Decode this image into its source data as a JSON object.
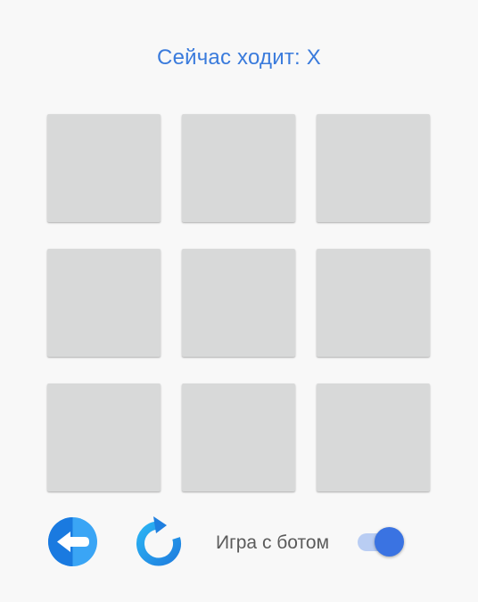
{
  "status": {
    "text": "Сейчас ходит: X"
  },
  "board": {
    "cells": [
      "",
      "",
      "",
      "",
      "",
      "",
      "",
      "",
      ""
    ]
  },
  "controls": {
    "back_icon": "arrow-left-icon",
    "restart_icon": "restart-icon",
    "bot_label": "Игра с ботом",
    "bot_toggle_on": true
  },
  "colors": {
    "accent": "#3a7bdc",
    "cell": "#d8d9d9",
    "background": "#f8f8f8",
    "back_dark": "#1a7ae0",
    "back_light": "#3aa5f5",
    "restart_light": "#2bb3f3",
    "restart_dark": "#1f7fdf",
    "toggle_track": "#b9cdf3",
    "toggle_knob": "#3a73e2"
  }
}
